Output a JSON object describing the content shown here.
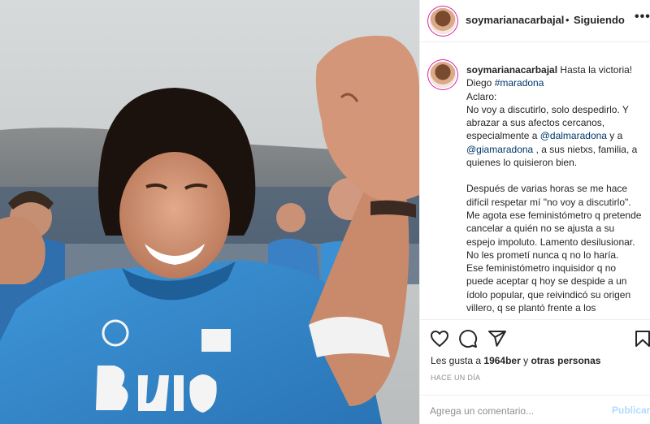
{
  "header": {
    "username": "soymarianacarbajal",
    "separator": "•",
    "follow_status": "Siguiendo",
    "more_label": "•••"
  },
  "caption": {
    "username": "soymarianacarbajal",
    "line1": "Hasta la victoria!",
    "line2_text": "Diego ",
    "line2_tag": "#maradona",
    "line3": "Aclaro:",
    "para1_a": "No voy a discutirlo, solo despedirlo. Y abrazar a sus afectos cercanos, especialmente a ",
    "mention1": "@dalmaradona",
    "para1_b": " y a ",
    "mention2": "@giamaradona",
    "para1_c": " , a sus nietxs, familia, a quienes lo quisieron bien.",
    "para2": "Después de varias horas se me hace difícil respetar mí \"no voy a discutirlo\". Me agota ese feministómetro q pretende cancelar a quién no se ajusta a su espejo impoluto. Lamento desilusionar. No les prometí nunca q no lo haría.",
    "para3": "Ese feministómetro inquisidor q no puede aceptar q hoy se despide a un ídolo popular, que reivindicó su origen villero, q se plantó frente a los"
  },
  "actions": {
    "icons": [
      "heart-icon",
      "comment-icon",
      "share-icon",
      "bookmark-icon"
    ],
    "likes_prefix": "Les gusta a ",
    "likes_user": "1964ber",
    "likes_middle": " y ",
    "likes_others": "otras personas",
    "timestamp": "HACE UN DÍA"
  },
  "comment": {
    "placeholder": "Agrega un comentario...",
    "post_label": "Publicar"
  },
  "colors": {
    "link": "#00376b",
    "post_disabled": "#b3dbff",
    "muted": "#8e8e8e",
    "jersey_blue": "#2f84c9"
  }
}
